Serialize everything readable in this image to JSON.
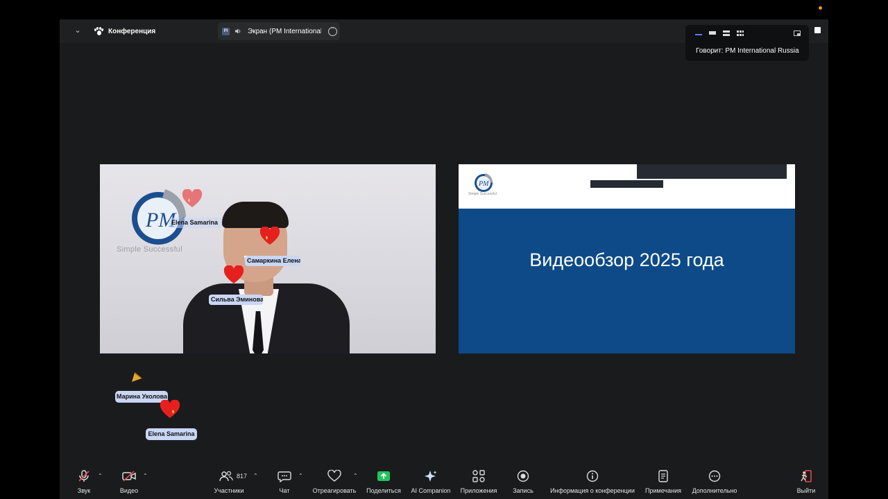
{
  "topbar": {
    "conference_label": "Конференция",
    "tab_badge": "PI",
    "tab_title": "Экран (PM International"
  },
  "speaker_popup": {
    "label": "Говорит: PM International Russia"
  },
  "video_tile": {
    "logo_text": "Simple Successful",
    "logo_letters": "PM",
    "chips": [
      {
        "text": "Elena Samarina"
      },
      {
        "text": "Самаркина Елена"
      },
      {
        "text": "Сильва Эминова"
      }
    ]
  },
  "share_tile": {
    "slide_title": "Видеообзор 2025 года",
    "logo_letters": "PM",
    "logo_tag": "Simple Successful"
  },
  "floating_reactions": [
    {
      "text": "Марина Уколова"
    },
    {
      "text": "Elena Samarina"
    }
  ],
  "toolbar": {
    "audio": "Звук",
    "video": "Видео",
    "participants": "Участники",
    "participants_count": "817",
    "chat": "Чат",
    "react": "Отреагировать",
    "share": "Поделиться",
    "ai": "AI Companion",
    "apps": "Приложения",
    "record": "Запись",
    "info": "Информация о конференции",
    "notes": "Примечания",
    "more": "Дополнительно",
    "leave": "Выйти"
  },
  "colors": {
    "accent_blue": "#5b7cff",
    "slide_blue": "#0d4a87",
    "share_green": "#22c55e",
    "leave_red": "#e5484d",
    "name_chip": "#c9d6f5"
  }
}
